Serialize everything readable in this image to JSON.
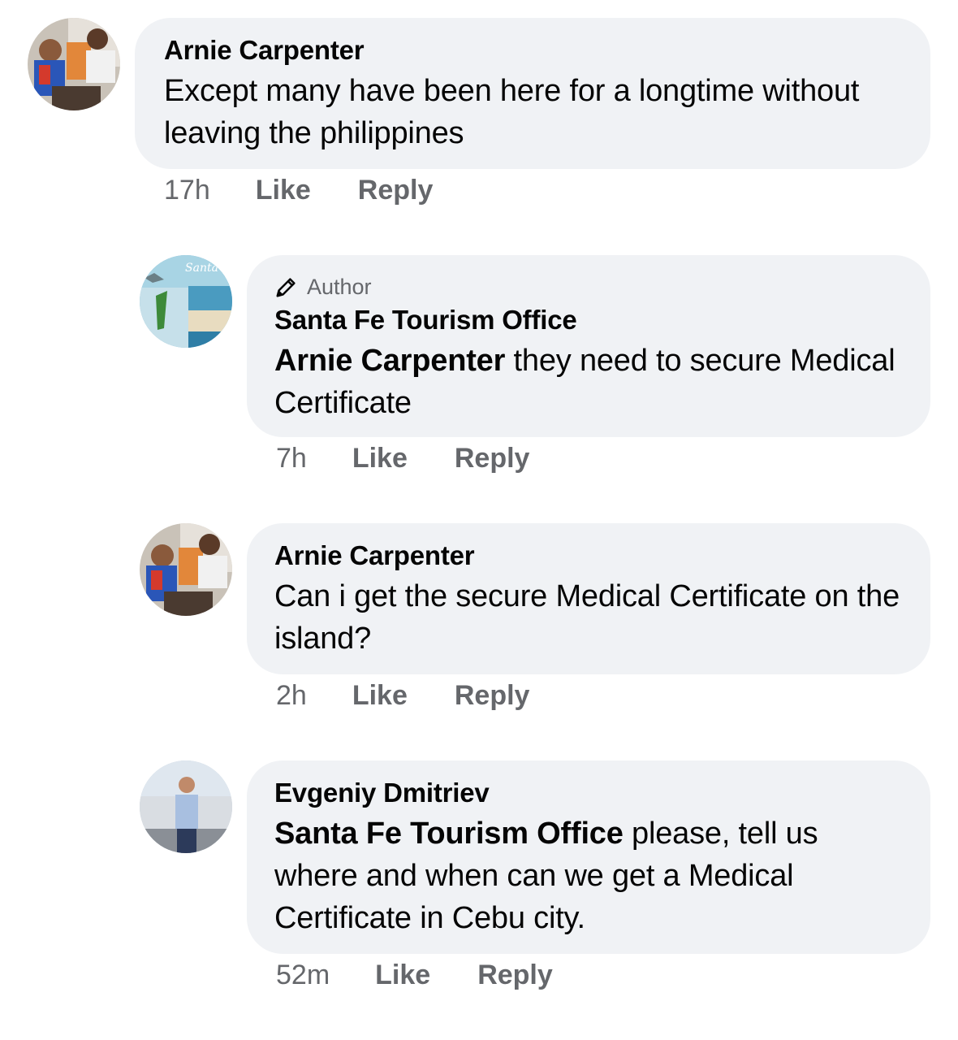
{
  "comments": [
    {
      "author": "Arnie Carpenter",
      "text": "Except many have been here for a longtime without leaving the philippines",
      "time": "17h",
      "like_label": "Like",
      "reply_label": "Reply"
    },
    {
      "badge": "Author",
      "author": "Santa Fe Tourism Office",
      "mention": "Arnie Carpenter",
      "text": " they need to secure Medical Certificate",
      "time": "7h",
      "like_label": "Like",
      "reply_label": "Reply"
    },
    {
      "author": "Arnie Carpenter",
      "text": "Can i get the secure Medical Certificate on the island?",
      "time": "2h",
      "like_label": "Like",
      "reply_label": "Reply"
    },
    {
      "author": "Evgeniy Dmitriev",
      "mention": "Santa Fe Tourism Office",
      "text": " please, tell us where and when can we get a Medical Certificate in Cebu city.",
      "time": "52m",
      "like_label": "Like",
      "reply_label": "Reply"
    }
  ],
  "avatars": {
    "santa_fe_logo_text": "Santa"
  },
  "icons": {
    "author_badge": "pencil-icon"
  },
  "colors": {
    "bubble": "#f0f2f5",
    "secondary_text": "#65676b",
    "primary_text": "#050505"
  }
}
